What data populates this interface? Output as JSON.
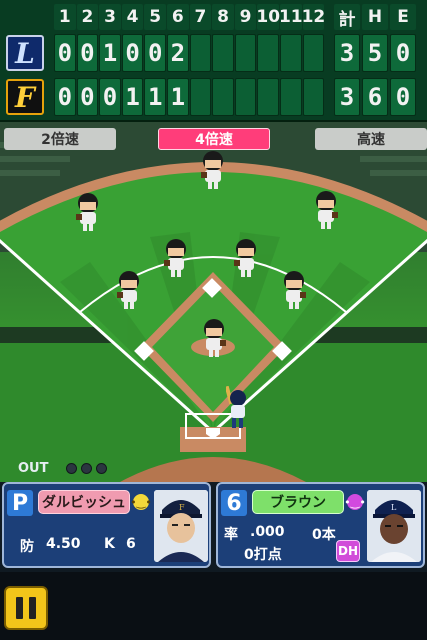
{
  "scoreboard": {
    "innings": [
      "1",
      "2",
      "3",
      "4",
      "5",
      "6",
      "7",
      "8",
      "9",
      "10",
      "11",
      "12"
    ],
    "total_label": "計",
    "hits_label": "H",
    "errors_label": "E",
    "teams": [
      {
        "logo_letter": "L",
        "innings": [
          "0",
          "0",
          "1",
          "0",
          "0",
          "2",
          "",
          "",
          "",
          "",
          "",
          ""
        ],
        "total": "3",
        "hits": "5",
        "errors": "0"
      },
      {
        "logo_letter": "F",
        "innings": [
          "0",
          "0",
          "0",
          "1",
          "1",
          "1",
          "",
          "",
          "",
          "",
          "",
          ""
        ],
        "total": "3",
        "hits": "6",
        "errors": "0"
      }
    ]
  },
  "speed": {
    "slow_label": "2倍速",
    "active_label": "4倍速",
    "fast_label": "高速"
  },
  "outs": {
    "label": "OUT",
    "count": 0,
    "max": 3
  },
  "pitcher": {
    "role": "P",
    "name": "ダルビッシュ",
    "era_label": "防",
    "era": "4.50",
    "k_label": "K",
    "k": "6",
    "mood": "yellow-face-icon"
  },
  "batter": {
    "order": "6",
    "name": "ブラウン",
    "avg_label": "率",
    "avg": ".000",
    "hr": "0本",
    "rbi": "0打点",
    "position": "DH",
    "mood": "purple-face-icon"
  },
  "colors": {
    "scoreboard_bg": "#083c22",
    "cell_bg": "#0e6a3a",
    "active_speed": "#ff3d7a",
    "panel_bg": "#1c3f78",
    "pitcher_name": "#f09bb0",
    "batter_name": "#7ee06a",
    "pause_button": "#f2c51a"
  }
}
